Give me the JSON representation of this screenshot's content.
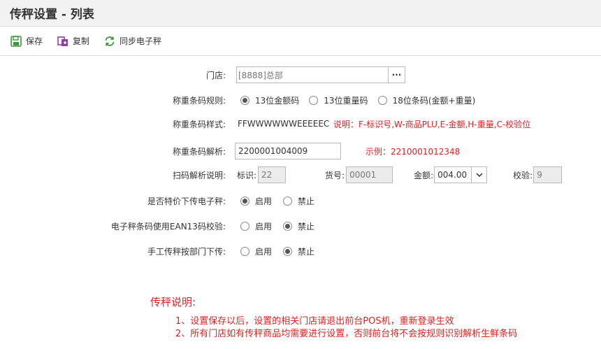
{
  "title": "传秤设置 - 列表",
  "toolbar": {
    "save_label": "保存",
    "copy_label": "复制",
    "sync_label": "同步电子秤"
  },
  "store": {
    "label": "门店:",
    "value": "[8888]总部",
    "picker_label": "···"
  },
  "barcode_rule": {
    "label": "称重条码规则:",
    "options": [
      "13位金额码",
      "13位重量码",
      "18位条码(金额+重量)"
    ],
    "selected_index": 0
  },
  "barcode_style": {
    "label": "称重条码样式:",
    "value": "FFWWWWWWEEEEEC",
    "note": "说明：F-标识号,W-商品PLU,E-金额,H-重量,C-校验位"
  },
  "barcode_parse": {
    "label": "称重条码解析:",
    "value": "2200001004009",
    "example": "示例：2210001012348"
  },
  "scan_explain": {
    "label": "扫码解析说明:",
    "flag_label": "标识:",
    "flag_value": "22",
    "item_label": "货号:",
    "item_value": "00001",
    "amount_label": "金额:",
    "amount_value": "004.00",
    "check_label": "校验:",
    "check_value": "9"
  },
  "special_price": {
    "label": "是否特价下传电子秤:",
    "options": [
      "启用",
      "禁止"
    ],
    "selected_index": 0
  },
  "ean13_check": {
    "label": "电子秤条码使用EAN13码校验:",
    "options": [
      "启用",
      "禁止"
    ],
    "selected_index": 1
  },
  "manual_by_dept": {
    "label": "手工传秤按部门下传:",
    "options": [
      "启用",
      "禁止"
    ],
    "selected_index": 1
  },
  "notes": {
    "heading": "传秤说明:",
    "items": [
      "1、设置保存以后，设置的相关门店请退出前台POS机，重新登录生效",
      "2、所有门店如有传秤商品均需要进行设置，否则前台将不会按规则识别解析生鲜条码"
    ]
  },
  "colors": {
    "accent_green": "#3a9a3a",
    "accent_purple": "#8e3fa8",
    "note_red": "#e02020"
  }
}
